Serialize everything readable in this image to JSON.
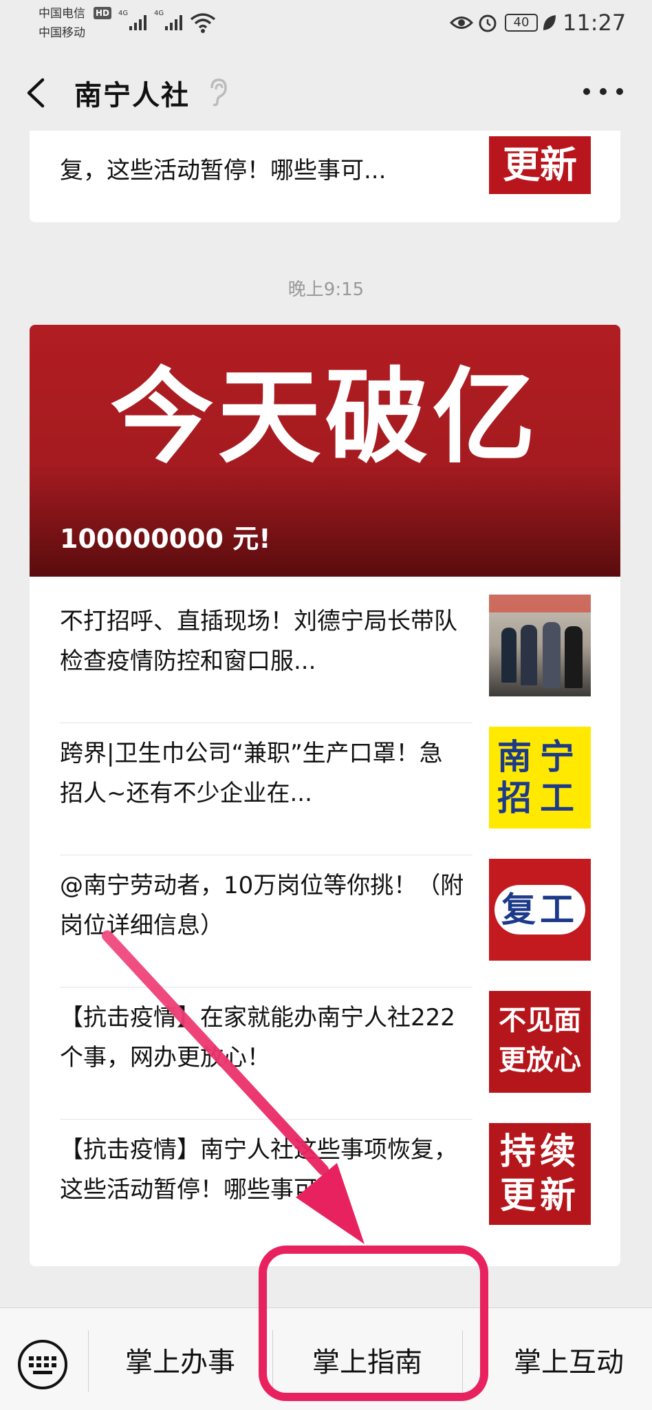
{
  "status_bar": {
    "carrier_1": "中国电信",
    "carrier_1_badge": "HD",
    "carrier_2": "中国移动",
    "net_1": "4G",
    "net_2": "4G",
    "battery": "40",
    "time": "11:27"
  },
  "header": {
    "title": "南宁人社"
  },
  "previous_message": {
    "text": "复，这些活动暂停！哪些事可...",
    "thumb_text": "更新"
  },
  "timestamp": "晚上9:15",
  "main_article": {
    "headline": "今天破亿",
    "subline": "100000000 元!"
  },
  "articles": [
    {
      "title": "不打招呼、直插现场！刘德宁局长带队检查疫情防控和窗口服...",
      "thumb": "photo"
    },
    {
      "title": "跨界|卫生巾公司“兼职”生产口罩！急招人~还有不少企业在...",
      "thumb_text": "南宁招工"
    },
    {
      "title": "@南宁劳动者，10万岗位等你挑！（附岗位详细信息）",
      "thumb_text": "复工"
    },
    {
      "title": "【抗击疫情】在家就能办南宁人社222个事，网办更放心！",
      "thumb_text": "不见面更放心"
    },
    {
      "title": "【抗击疫情】南宁人社这些事项恢复，这些活动暂停！哪些事可...",
      "thumb_text": "持续更新"
    }
  ],
  "menu": {
    "items": [
      "掌上办事",
      "掌上指南",
      "掌上互动"
    ]
  },
  "colors": {
    "annotation": "#e8215f",
    "banner_red": "#b11d22"
  }
}
